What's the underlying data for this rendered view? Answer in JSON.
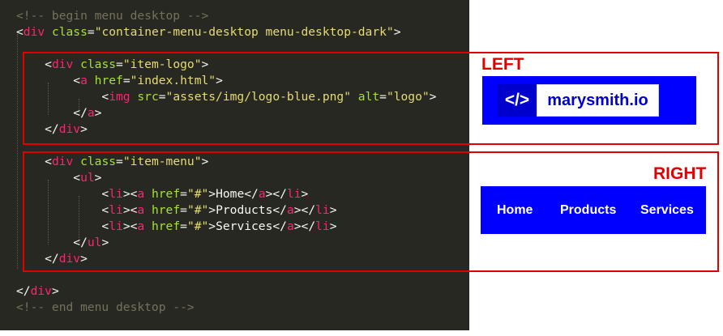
{
  "code_lines": [
    [
      {
        "t": "<!-- begin menu desktop -->",
        "c": "comment"
      }
    ],
    [
      {
        "t": "<",
        "c": "text"
      },
      {
        "t": "div",
        "c": "tag"
      },
      {
        "t": " ",
        "c": "text"
      },
      {
        "t": "class",
        "c": "attr"
      },
      {
        "t": "=",
        "c": "text"
      },
      {
        "t": "\"container-menu-desktop menu-desktop-dark\"",
        "c": "str"
      },
      {
        "t": ">",
        "c": "text"
      }
    ],
    [],
    [
      {
        "t": "    <",
        "c": "text"
      },
      {
        "t": "div",
        "c": "tag"
      },
      {
        "t": " ",
        "c": "text"
      },
      {
        "t": "class",
        "c": "attr"
      },
      {
        "t": "=",
        "c": "text"
      },
      {
        "t": "\"item-logo\"",
        "c": "str"
      },
      {
        "t": ">",
        "c": "text"
      }
    ],
    [
      {
        "t": "        <",
        "c": "text"
      },
      {
        "t": "a",
        "c": "tag"
      },
      {
        "t": " ",
        "c": "text"
      },
      {
        "t": "href",
        "c": "attr"
      },
      {
        "t": "=",
        "c": "text"
      },
      {
        "t": "\"index.html\"",
        "c": "str"
      },
      {
        "t": ">",
        "c": "text"
      }
    ],
    [
      {
        "t": "            <",
        "c": "text"
      },
      {
        "t": "img",
        "c": "tag"
      },
      {
        "t": " ",
        "c": "text"
      },
      {
        "t": "src",
        "c": "attr"
      },
      {
        "t": "=",
        "c": "text"
      },
      {
        "t": "\"assets/img/logo-blue.png\"",
        "c": "str"
      },
      {
        "t": " ",
        "c": "text"
      },
      {
        "t": "alt",
        "c": "attr"
      },
      {
        "t": "=",
        "c": "text"
      },
      {
        "t": "\"logo\"",
        "c": "str"
      },
      {
        "t": ">",
        "c": "text"
      }
    ],
    [
      {
        "t": "        </",
        "c": "text"
      },
      {
        "t": "a",
        "c": "tag"
      },
      {
        "t": ">",
        "c": "text"
      }
    ],
    [
      {
        "t": "    </",
        "c": "text"
      },
      {
        "t": "div",
        "c": "tag"
      },
      {
        "t": ">",
        "c": "text"
      }
    ],
    [],
    [
      {
        "t": "    <",
        "c": "text"
      },
      {
        "t": "div",
        "c": "tag"
      },
      {
        "t": " ",
        "c": "text"
      },
      {
        "t": "class",
        "c": "attr"
      },
      {
        "t": "=",
        "c": "text"
      },
      {
        "t": "\"item-menu\"",
        "c": "str"
      },
      {
        "t": ">",
        "c": "text"
      }
    ],
    [
      {
        "t": "        <",
        "c": "text"
      },
      {
        "t": "ul",
        "c": "tag"
      },
      {
        "t": ">",
        "c": "text"
      }
    ],
    [
      {
        "t": "            <",
        "c": "text"
      },
      {
        "t": "li",
        "c": "tag"
      },
      {
        "t": "><",
        "c": "text"
      },
      {
        "t": "a",
        "c": "tag"
      },
      {
        "t": " ",
        "c": "text"
      },
      {
        "t": "href",
        "c": "attr"
      },
      {
        "t": "=",
        "c": "text"
      },
      {
        "t": "\"#\"",
        "c": "str"
      },
      {
        "t": ">Home</",
        "c": "text"
      },
      {
        "t": "a",
        "c": "tag"
      },
      {
        "t": "></",
        "c": "text"
      },
      {
        "t": "li",
        "c": "tag"
      },
      {
        "t": ">",
        "c": "text"
      }
    ],
    [
      {
        "t": "            <",
        "c": "text"
      },
      {
        "t": "li",
        "c": "tag"
      },
      {
        "t": "><",
        "c": "text"
      },
      {
        "t": "a",
        "c": "tag"
      },
      {
        "t": " ",
        "c": "text"
      },
      {
        "t": "href",
        "c": "attr"
      },
      {
        "t": "=",
        "c": "text"
      },
      {
        "t": "\"#\"",
        "c": "str"
      },
      {
        "t": ">Products</",
        "c": "text"
      },
      {
        "t": "a",
        "c": "tag"
      },
      {
        "t": "></",
        "c": "text"
      },
      {
        "t": "li",
        "c": "tag"
      },
      {
        "t": ">",
        "c": "text"
      }
    ],
    [
      {
        "t": "            <",
        "c": "text"
      },
      {
        "t": "li",
        "c": "tag"
      },
      {
        "t": "><",
        "c": "text"
      },
      {
        "t": "a",
        "c": "tag"
      },
      {
        "t": " ",
        "c": "text"
      },
      {
        "t": "href",
        "c": "attr"
      },
      {
        "t": "=",
        "c": "text"
      },
      {
        "t": "\"#\"",
        "c": "str"
      },
      {
        "t": ">Services</",
        "c": "text"
      },
      {
        "t": "a",
        "c": "tag"
      },
      {
        "t": "></",
        "c": "text"
      },
      {
        "t": "li",
        "c": "tag"
      },
      {
        "t": ">",
        "c": "text"
      }
    ],
    [
      {
        "t": "        </",
        "c": "text"
      },
      {
        "t": "ul",
        "c": "tag"
      },
      {
        "t": ">",
        "c": "text"
      }
    ],
    [
      {
        "t": "    </",
        "c": "text"
      },
      {
        "t": "div",
        "c": "tag"
      },
      {
        "t": ">",
        "c": "text"
      }
    ],
    [],
    [
      {
        "t": "</",
        "c": "text"
      },
      {
        "t": "div",
        "c": "tag"
      },
      {
        "t": ">",
        "c": "text"
      }
    ],
    [
      {
        "t": "<!-- end menu desktop -->",
        "c": "comment"
      }
    ]
  ],
  "annotations": {
    "left_label": "LEFT",
    "right_label": "RIGHT"
  },
  "logo_preview": {
    "icon_glyph": "</>",
    "icon_name": "code-brackets-icon",
    "brand_text": "marysmith.io"
  },
  "menu_preview": {
    "items": [
      {
        "label": "Home"
      },
      {
        "label": "Products"
      },
      {
        "label": "Services"
      }
    ]
  },
  "colors": {
    "editor_bg": "#272822",
    "comment": "#75715e",
    "tag": "#f92672",
    "attribute": "#a6e22e",
    "string": "#e6db74",
    "annotation_red": "#e00000",
    "menu_blue": "#0000ff"
  }
}
